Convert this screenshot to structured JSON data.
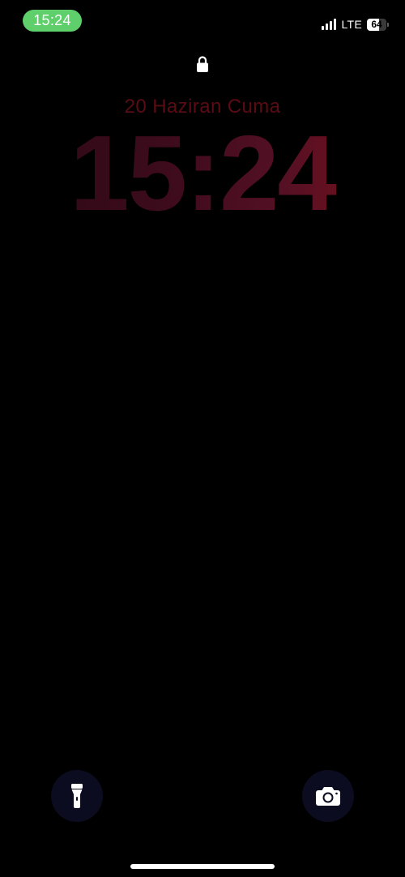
{
  "status_bar": {
    "time": "15:24",
    "network": "LTE",
    "battery_percent": "64",
    "battery_level": 0.64,
    "signal_bars": 4,
    "time_pill_color": "#5fcf6b"
  },
  "lock_screen": {
    "lock_icon": "lock-icon",
    "date": "20 Haziran Cuma",
    "time": "15:24",
    "date_color": "#5a0c14"
  },
  "quick_actions": {
    "flashlight_icon": "flashlight-icon",
    "camera_icon": "camera-icon"
  }
}
